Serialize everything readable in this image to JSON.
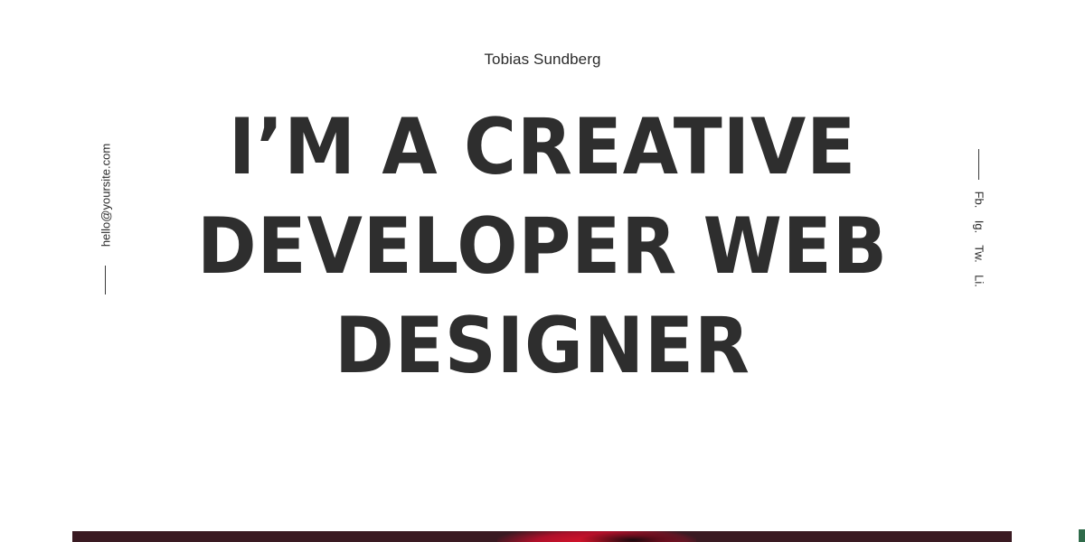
{
  "header": {
    "site_name": "Tobias Sundberg"
  },
  "hero": {
    "lines": [
      "I’M A CREATIVE",
      "DEVELOPER WEB",
      "DESIGNER"
    ]
  },
  "contact": {
    "email": "hello@yoursite.com"
  },
  "social": {
    "items": [
      {
        "label": "Fb.",
        "icon": "facebook"
      },
      {
        "label": "Ig.",
        "icon": "instagram"
      },
      {
        "label": "Tw.",
        "icon": "twitter"
      },
      {
        "label": "Li.",
        "icon": "linkedin"
      }
    ]
  },
  "colors": {
    "text": "#2e2e2e",
    "background": "#ffffff",
    "image_dark": "#3a1a22",
    "image_accent": "#e0142a"
  }
}
